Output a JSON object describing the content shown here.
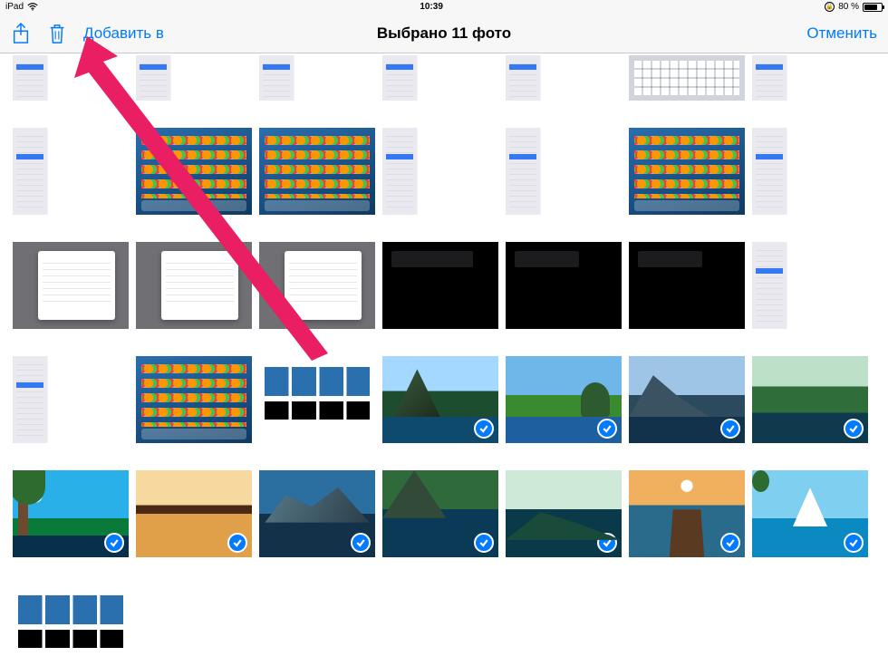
{
  "status": {
    "device": "iPad",
    "time": "10:39",
    "battery_pct": "80 %",
    "battery_fill_pct": 80
  },
  "nav": {
    "add_to_label": "Добавить в",
    "title": "Выбрано 11 фото",
    "cancel_label": "Отменить"
  },
  "grid": {
    "rows": [
      {
        "height": "short",
        "thumbs": [
          {
            "style": "t-settings"
          },
          {
            "style": "t-settings"
          },
          {
            "style": "t-settings"
          },
          {
            "style": "t-settings"
          },
          {
            "style": "t-settings"
          },
          {
            "style": "t-keyboard"
          },
          {
            "style": "t-settings"
          }
        ]
      },
      {
        "thumbs": [
          {
            "style": "t-settings"
          },
          {
            "style": "t-homescreen"
          },
          {
            "style": "t-homescreen"
          },
          {
            "style": "t-settings"
          },
          {
            "style": "t-settings"
          },
          {
            "style": "t-homescreen"
          },
          {
            "style": "t-settings"
          }
        ]
      },
      {
        "thumbs": [
          {
            "style": "t-popup"
          },
          {
            "style": "t-popup"
          },
          {
            "style": "t-popup"
          },
          {
            "style": "t-dark"
          },
          {
            "style": "t-dark alt"
          },
          {
            "style": "t-dark alt"
          },
          {
            "style": "t-settings"
          }
        ]
      },
      {
        "thumbs": [
          {
            "style": "t-settings"
          },
          {
            "style": "t-homescreen"
          },
          {
            "style": "t-fileboxes"
          },
          {
            "style": "t-land l1",
            "selected": true
          },
          {
            "style": "t-land l2",
            "selected": true
          },
          {
            "style": "t-land l3",
            "selected": true
          },
          {
            "style": "t-land l4",
            "selected": true
          }
        ]
      },
      {
        "thumbs": [
          {
            "style": "t-land l5",
            "selected": true
          },
          {
            "style": "t-land l6",
            "selected": true
          },
          {
            "style": "t-land l7",
            "selected": true
          },
          {
            "style": "t-land l8",
            "selected": true
          },
          {
            "style": "t-land l9",
            "selected": true
          },
          {
            "style": "t-land l10",
            "selected": true
          },
          {
            "style": "t-land l11",
            "selected": true
          }
        ]
      },
      {
        "thumbs": [
          {
            "style": "t-fileboxes"
          }
        ]
      }
    ]
  },
  "annotation": {
    "arrow_color": "#e91e63"
  }
}
